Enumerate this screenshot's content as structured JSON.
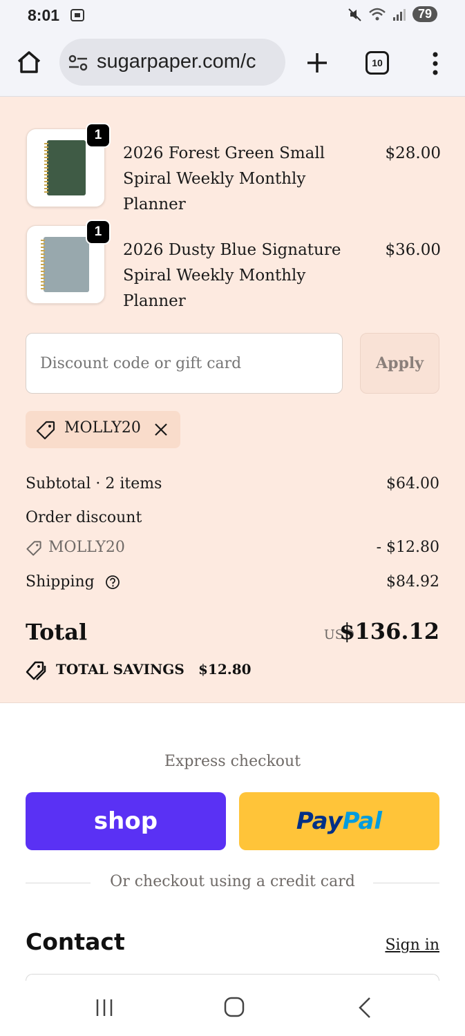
{
  "status_bar": {
    "time": "8:01",
    "battery": "79"
  },
  "browser": {
    "url": "sugarpaper.com/c",
    "tab_count": "10"
  },
  "cart": {
    "items": [
      {
        "name": "2026 Forest Green Small Spiral Weekly Monthly Planner",
        "price": "$28.00",
        "quantity": "1",
        "cover_color": "#3f5b45"
      },
      {
        "name": "2026 Dusty Blue Signature Spiral Weekly Monthly Planner",
        "price": "$36.00",
        "quantity": "1",
        "cover_color": "#98a8ad"
      }
    ]
  },
  "discount": {
    "placeholder": "Discount code or gift card",
    "apply_label": "Apply",
    "applied_code": "MOLLY20"
  },
  "summary": {
    "subtotal_label": "Subtotal · 2 items",
    "subtotal_value": "$64.00",
    "order_discount_label": "Order discount",
    "order_discount_code": "MOLLY20",
    "order_discount_value": "- $12.80",
    "shipping_label": "Shipping",
    "shipping_value": "$84.92",
    "total_label": "Total",
    "currency": "USD",
    "total_value": "$136.12",
    "savings_label": "TOTAL SAVINGS",
    "savings_value": "$12.80"
  },
  "express": {
    "title": "Express checkout",
    "shop_label": "shop",
    "paypal_label_1": "Pay",
    "paypal_label_2": "Pal",
    "divider_text": "Or checkout using a credit card"
  },
  "contact": {
    "title": "Contact",
    "sign_in": "Sign in"
  },
  "colors": {
    "summary_bg": "#fdeae0",
    "shop_purple": "#5a31f4",
    "paypal_yellow": "#ffc439"
  }
}
